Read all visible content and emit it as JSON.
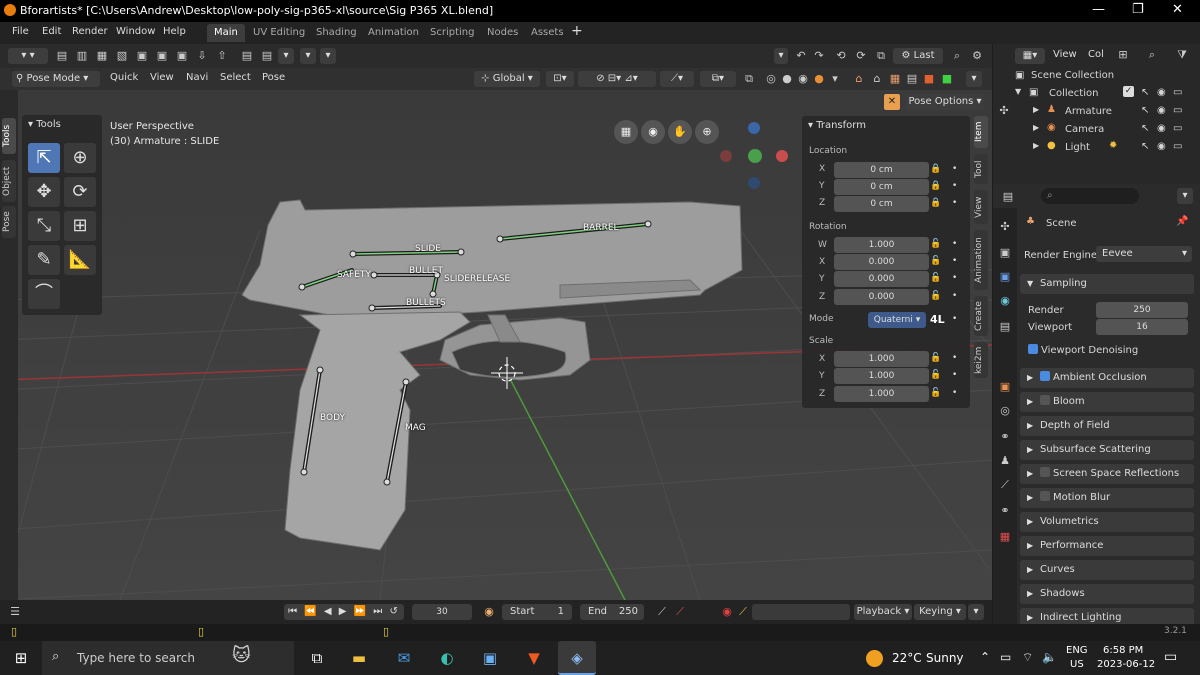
{
  "window": {
    "title": "Bforartists* [C:\\Users\\Andrew\\Desktop\\low-poly-sig-p365-xl\\source\\Sig P365 XL.blend]"
  },
  "menu": [
    "File",
    "Edit",
    "Render",
    "Window",
    "Help"
  ],
  "workspaces": [
    "Main",
    "UV Editing",
    "Shading",
    "Animation",
    "Scripting",
    "Nodes",
    "Assets"
  ],
  "header": {
    "mode": "Pose Mode",
    "items": [
      "Quick",
      "View",
      "Navi",
      "Select",
      "Pose"
    ],
    "orientation": "Global",
    "last": "Last",
    "pose_options": "Pose Options"
  },
  "viewport": {
    "perspective": "User Perspective",
    "object": "(30) Armature : SLIDE"
  },
  "bones": [
    "SLIDE",
    "BARREL",
    "SAFETY",
    "BULLET",
    "SLIDERELEASE",
    "BULLETS",
    "BODY",
    "MAG"
  ],
  "left_tabs": [
    "Tools",
    "Object",
    "Pose"
  ],
  "tools_title": "Tools",
  "transform": {
    "title": "Transform",
    "location_label": "Location",
    "location": {
      "x": "0 cm",
      "y": "0 cm",
      "z": "0 cm"
    },
    "rotation_label": "Rotation",
    "rotation": {
      "w": "1.000",
      "x": "0.000",
      "y": "0.000",
      "z": "0.000"
    },
    "mode_label": "Mode",
    "mode": "Quaterni",
    "mode_suffix": "4L",
    "scale_label": "Scale",
    "scale": {
      "x": "1.000",
      "y": "1.000",
      "z": "1.000"
    },
    "axes": {
      "w": "W",
      "x": "X",
      "y": "Y",
      "z": "Z"
    }
  },
  "right_tabs": [
    "Item",
    "Tool",
    "View",
    "Animation",
    "Create",
    "kei2m"
  ],
  "outliner": {
    "view": "View",
    "col": "Col",
    "scene_collection": "Scene Collection",
    "collection": "Collection",
    "items": [
      "Armature",
      "Camera",
      "Light"
    ]
  },
  "properties": {
    "scene": "Scene",
    "render_engine_label": "Render Engine",
    "render_engine": "Eevee",
    "sampling": "Sampling",
    "render_label": "Render",
    "render": "250",
    "viewport_label": "Viewport",
    "viewport": "16",
    "viewport_denoising": "Viewport Denoising",
    "sections": [
      {
        "label": "Ambient Occlusion",
        "checkbox": true,
        "checked": true
      },
      {
        "label": "Bloom",
        "checkbox": true,
        "checked": false
      },
      {
        "label": "Depth of Field",
        "checkbox": false
      },
      {
        "label": "Subsurface Scattering",
        "checkbox": false
      },
      {
        "label": "Screen Space Reflections",
        "checkbox": true,
        "checked": false
      },
      {
        "label": "Motion Blur",
        "checkbox": true,
        "checked": false
      },
      {
        "label": "Volumetrics",
        "checkbox": false
      },
      {
        "label": "Performance",
        "checkbox": false
      },
      {
        "label": "Curves",
        "checkbox": false
      },
      {
        "label": "Shadows",
        "checkbox": false
      },
      {
        "label": "Indirect Lighting",
        "checkbox": false
      }
    ]
  },
  "timeline": {
    "frame": "30",
    "start_label": "Start",
    "start": "1",
    "end_label": "End",
    "end": "250",
    "playback": "Playback",
    "keying": "Keying"
  },
  "version": "3.2.1",
  "taskbar": {
    "search": "Type here to search",
    "weather_temp": "22°C",
    "weather_desc": "Sunny",
    "lang": "ENG",
    "region": "US",
    "time": "6:58 PM",
    "date": "2023-06-12"
  }
}
